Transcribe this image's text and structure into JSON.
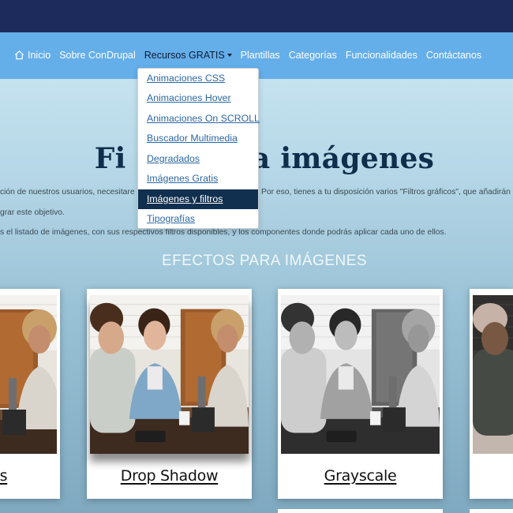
{
  "nav": {
    "items": [
      "Inicio",
      "Sobre ConDrupal",
      "Recursos GRATIS",
      "Plantillas",
      "Categorías",
      "Funcionalidades",
      "Contáctanos"
    ],
    "active_index": 2,
    "icons": {
      "home": "home-icon",
      "dropdown": "caret-down-icon"
    }
  },
  "dropdown": {
    "items": [
      "Animaciones CSS",
      "Animaciones Hover",
      "Animaciones On SCROLL",
      "Buscador Multimedia",
      "Degradados",
      "Imágenes Gratis",
      "Imágenes y filtros",
      "Tipografías"
    ],
    "selected_index": 6
  },
  "hero": {
    "title_left": "Fi",
    "title_right": "ra imágenes"
  },
  "intro": {
    "line1_left": "ción de nuestros usuarios, necesitare",
    "line1_right": "Por eso, tienes a tu disposición varios \"Filtros gráficos\", que añadirán",
    "line2": "grar este objetivo.",
    "line3_left": "s el listado de imágenes, con sus respectivos filtros disponibles",
    "line3_right": ", y los componentes donde podrás aplicar cada uno de ellos."
  },
  "section": {
    "title": "EFECTOS PARA IMÁGENES"
  },
  "cards": [
    {
      "label": "ss",
      "filter": "none"
    },
    {
      "label": "Drop Shadow",
      "filter": "drop-shadow"
    },
    {
      "label": "Grayscale",
      "filter": "grayscale"
    },
    {
      "label": "",
      "filter": "invert"
    }
  ],
  "colors": {
    "top_band": "#1c2b5c",
    "navbar": "#64aee9",
    "dropdown_selected": "#11304f",
    "link": "#2b67a5",
    "title": "#0e2e4b"
  }
}
